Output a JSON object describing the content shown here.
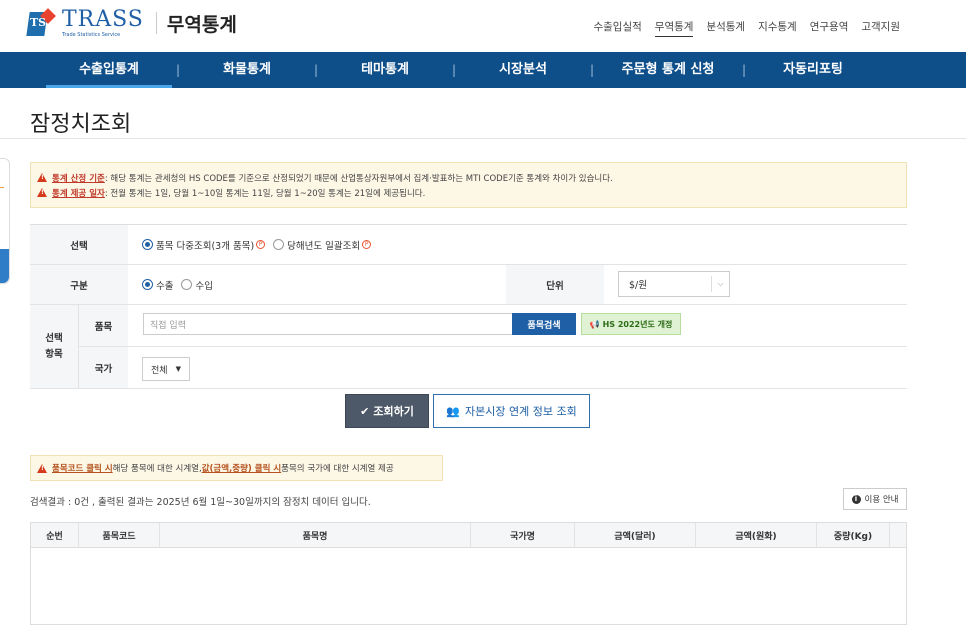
{
  "header": {
    "logo_text": "TRASS",
    "logo_sub": "Trade Statistics Service",
    "logo_mark": "TS",
    "site_title": "무역통계",
    "util_nav": [
      "수출입실적",
      "무역통계",
      "분석통계",
      "지수통계",
      "연구용역",
      "고객지원"
    ]
  },
  "main_nav": [
    "수출입통계",
    "화물통계",
    "테마통계",
    "시장분석",
    "주문형 통계 신청",
    "자동리포팅"
  ],
  "page_title": "잠정치조회",
  "notice": {
    "line1_label": "통계 산정 기준",
    "line1_text": ": 해당 통계는 관세청의 HS CODE를 기준으로 산정되었기 때문에 산업통상자원부에서 집계·발표하는 MTI CODE기준 통계와 차이가 있습니다.",
    "line2_label": "통계 제공 일자",
    "line2_text": ": 전월 통계는 1일, 당월 1~10일 통계는 11일, 당월 1~20일 통계는 21일에 제공됩니다."
  },
  "form": {
    "select_label": "선택",
    "select_options": [
      "품목 다중조회(3개 품목)",
      "당해년도 일괄조회"
    ],
    "p_mark": "P",
    "type_label": "구분",
    "type_options": [
      "수출",
      "수입"
    ],
    "unit_label": "단위",
    "unit_value": "$/원",
    "group_label": "선택\n항목",
    "item_label": "품목",
    "item_placeholder": "직접 입력",
    "item_search_btn": "품목검색",
    "hs_btn": "HS 2022년도 개정",
    "country_label": "국가",
    "country_value": "전체"
  },
  "buttons": {
    "search": "조회하기",
    "capital": "자본시장 연계 정보 조회"
  },
  "notice2": {
    "b1": "품목코드 클릭 시",
    "t1": " 해당 품목에 대한 시계열, ",
    "b2": "값(금액,중량) 클릭 시",
    "t2": " 품목의 국가에 대한 시계열 제공"
  },
  "result": {
    "text": "검색결과 : 0건 ,  출력된 결과는 2025년 6월 1일~30일까지의 잠정치 데이터 입니다.",
    "help": "이용 안내"
  },
  "table": {
    "columns": [
      "순번",
      "품목코드",
      "품목명",
      "국가명",
      "금액(달러)",
      "금액(원화)",
      "중량(Kg)"
    ]
  },
  "colors": {
    "nav": "#0e4f8a",
    "brand": "#1f5fa5",
    "warn": "#d63a1c"
  }
}
